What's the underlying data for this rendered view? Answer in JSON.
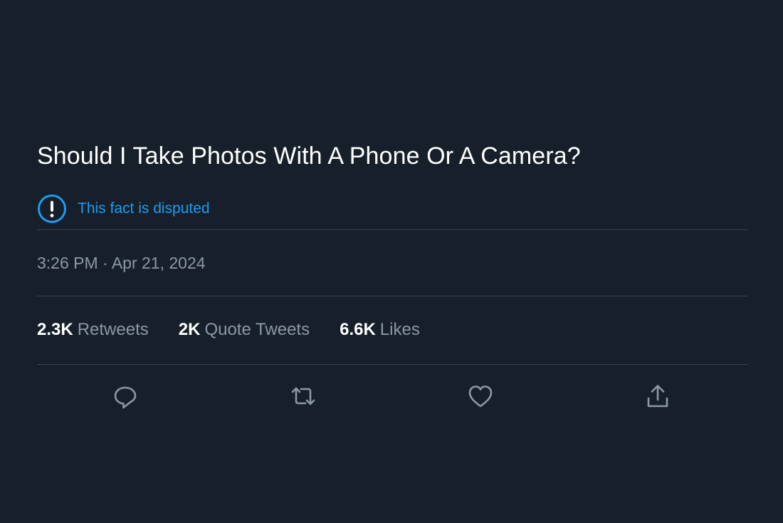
{
  "tweet": {
    "text": "Should I Take Photos With A Phone Or A Camera?",
    "notice": {
      "icon": "exclamation-circle-icon",
      "text": "This fact is disputed"
    },
    "timestamp": "3:26 PM · Apr 21, 2024",
    "stats": [
      {
        "count": "2.3K",
        "label": "Retweets"
      },
      {
        "count": "2K",
        "label": "Quote Tweets"
      },
      {
        "count": "6.6K",
        "label": "Likes"
      }
    ],
    "actions": [
      {
        "icon": "reply-icon"
      },
      {
        "icon": "retweet-icon"
      },
      {
        "icon": "like-icon"
      },
      {
        "icon": "share-icon"
      }
    ]
  },
  "colors": {
    "background": "#17202a",
    "text": "#ffffff",
    "muted": "#8b98a5",
    "accent": "#1d9bf0",
    "divider": "#38444d"
  }
}
